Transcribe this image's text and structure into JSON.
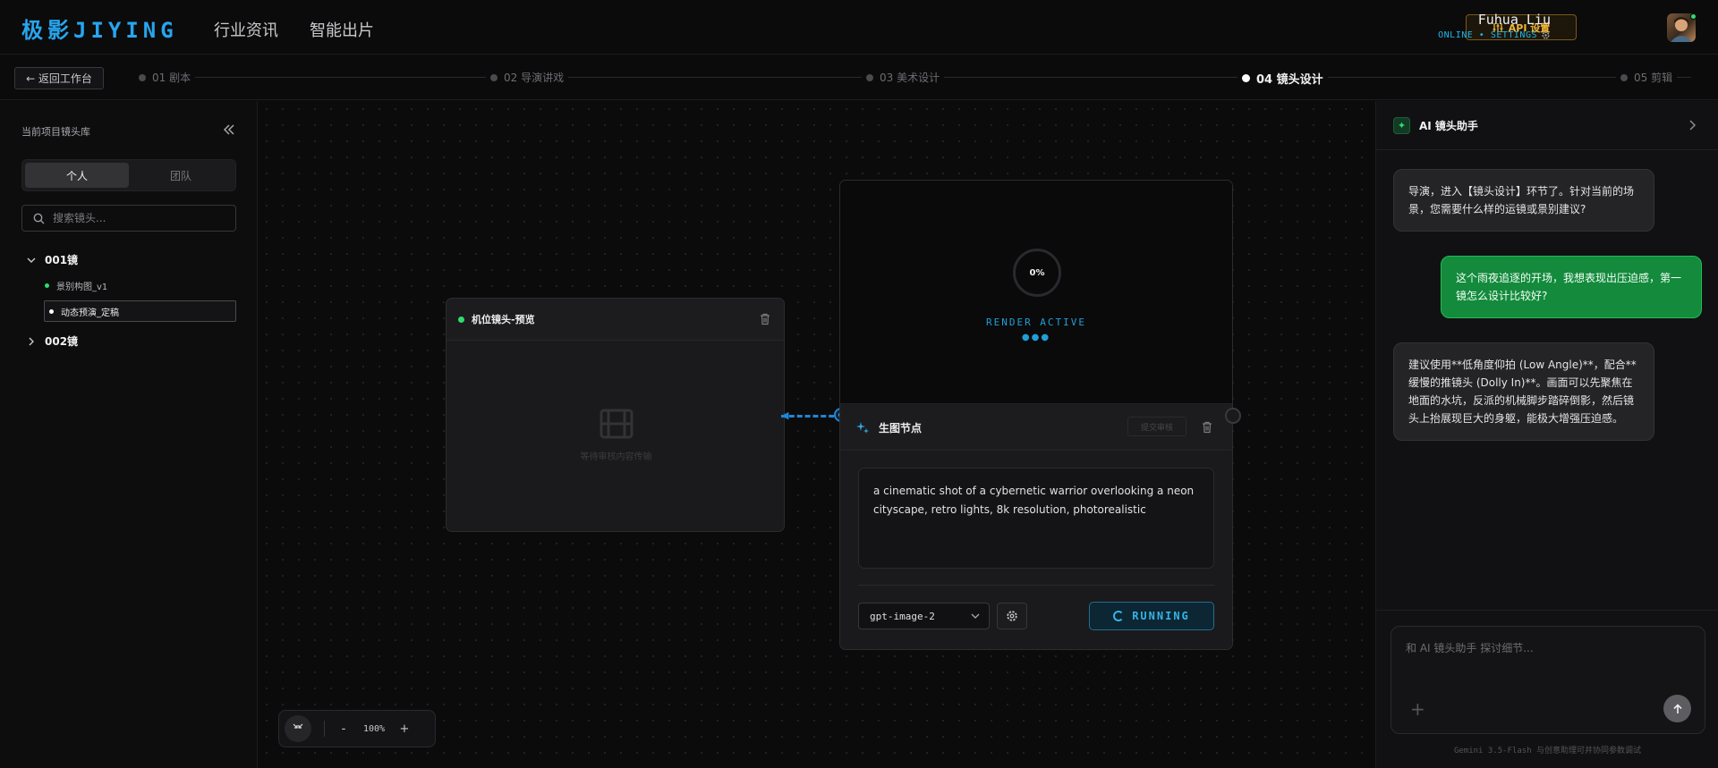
{
  "header": {
    "logo": "极影JIYING",
    "nav": [
      "行业资讯",
      "智能出片"
    ],
    "api_button": "API 设置",
    "user_name": "Fuhua Liu",
    "user_status": "ONLINE • SETTINGS"
  },
  "steps": {
    "back_label": "← 返回工作台",
    "items": [
      {
        "label": "01 剧本",
        "active": false
      },
      {
        "label": "02 导演讲戏",
        "active": false
      },
      {
        "label": "03 美术设计",
        "active": false
      },
      {
        "label": "04 镜头设计",
        "active": true
      },
      {
        "label": "05 剪辑",
        "active": false
      }
    ]
  },
  "library": {
    "title": "当前项目镜头库",
    "tabs": [
      "个人",
      "团队"
    ],
    "active_tab": "个人",
    "search_placeholder": "搜索镜头...",
    "groups": [
      {
        "label": "001镜",
        "expanded": true,
        "items": [
          {
            "label": "景别构图_v1",
            "dot": "#2fdc6e",
            "selected": false
          },
          {
            "label": "动态预演_定稿",
            "dot": "#ffffff",
            "selected": true
          }
        ]
      },
      {
        "label": "002镜",
        "expanded": false,
        "items": []
      }
    ]
  },
  "canvas": {
    "preview_node": {
      "title": "机位镜头-预览",
      "empty_text": "等待审核内容传输"
    },
    "gen_node": {
      "progress": "0%",
      "render_status": "RENDER ACTIVE",
      "render_dots": "●●●",
      "title": "生图节点",
      "submit_label": "提交审核",
      "prompt": "a cinematic shot of a cybernetic warrior overlooking a neon cityscape, retro lights, 8k resolution, photorealistic",
      "model": "gpt-image-2",
      "run_label": "RUNNING"
    },
    "zoom": {
      "minus": "-",
      "value": "100%",
      "plus": "+"
    }
  },
  "assistant": {
    "title": "AI 镜头助手",
    "messages": [
      {
        "role": "ai",
        "text": "导演，进入【镜头设计】环节了。针对当前的场景，您需要什么样的运镜或景别建议?"
      },
      {
        "role": "user",
        "text": "这个雨夜追逐的开场，我想表现出压迫感，第一镜怎么设计比较好?"
      },
      {
        "role": "ai",
        "text": "建议使用**低角度仰拍 (Low Angle)**，配合**缓慢的推镜头 (Dolly In)**。画面可以先聚焦在地面的水坑，反派的机械脚步踏碎倒影，然后镜头上抬展现巨大的身躯，能极大增强压迫感。"
      }
    ],
    "input_placeholder": "和 AI 镜头助手 探讨细节...",
    "footer": "Gemini 3.5-Flash 与创意助理可并协同参数调试"
  },
  "colors": {
    "accent_blue": "#27a5ee",
    "accent_green": "#2fdc6e",
    "api_gold": "#f0b73a"
  }
}
